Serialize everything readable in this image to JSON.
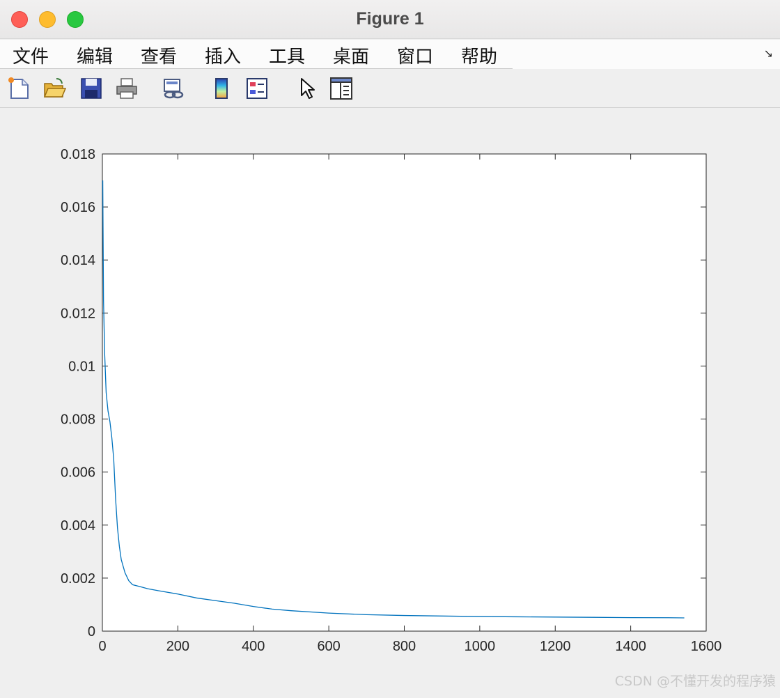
{
  "window": {
    "title": "Figure 1"
  },
  "menu": {
    "items": [
      "文件",
      "编辑",
      "查看",
      "插入",
      "工具",
      "桌面",
      "窗口",
      "帮助"
    ],
    "corner_glyph": "↘"
  },
  "toolbar": {
    "tools": [
      "new-figure-icon",
      "open-file-icon",
      "save-icon",
      "print-icon",
      "link-plot-icon",
      "colorbar-icon",
      "legend-icon",
      "pointer-icon",
      "property-inspector-icon"
    ]
  },
  "chart_data": {
    "type": "line",
    "title": "",
    "xlabel": "",
    "ylabel": "",
    "xlim": [
      0,
      1600
    ],
    "ylim": [
      0,
      0.018
    ],
    "xticks": [
      0,
      200,
      400,
      600,
      800,
      1000,
      1200,
      1400,
      1600
    ],
    "yticks": [
      0,
      0.002,
      0.004,
      0.006,
      0.008,
      0.01,
      0.012,
      0.014,
      0.016,
      0.018
    ],
    "xtick_labels": [
      "0",
      "200",
      "400",
      "600",
      "800",
      "1000",
      "1200",
      "1400",
      "1600"
    ],
    "ytick_labels": [
      "0",
      "0.002",
      "0.004",
      "0.006",
      "0.008",
      "0.01",
      "0.012",
      "0.014",
      "0.016",
      "0.018"
    ],
    "grid": false,
    "line_color": "#0072bd",
    "series": [
      {
        "x": [
          1,
          3,
          6,
          10,
          15,
          20,
          25,
          30,
          35,
          40,
          45,
          50,
          60,
          70,
          80,
          100,
          120,
          150,
          200,
          250,
          300,
          350,
          400,
          450,
          500,
          600,
          700,
          800,
          900,
          1000,
          1100,
          1200,
          1300,
          1400,
          1500,
          1542
        ],
        "y": [
          0.017,
          0.0125,
          0.0105,
          0.009,
          0.0083,
          0.0079,
          0.0073,
          0.0065,
          0.005,
          0.0039,
          0.0032,
          0.0027,
          0.0022,
          0.0019,
          0.00175,
          0.00168,
          0.0016,
          0.00152,
          0.0014,
          0.00125,
          0.00115,
          0.00105,
          0.00093,
          0.00083,
          0.00077,
          0.00068,
          0.00062,
          0.00059,
          0.00057,
          0.00055,
          0.00054,
          0.00053,
          0.00052,
          0.00051,
          0.000505,
          0.0005
        ]
      }
    ]
  },
  "watermark": "CSDN @不懂开发的程序猿"
}
